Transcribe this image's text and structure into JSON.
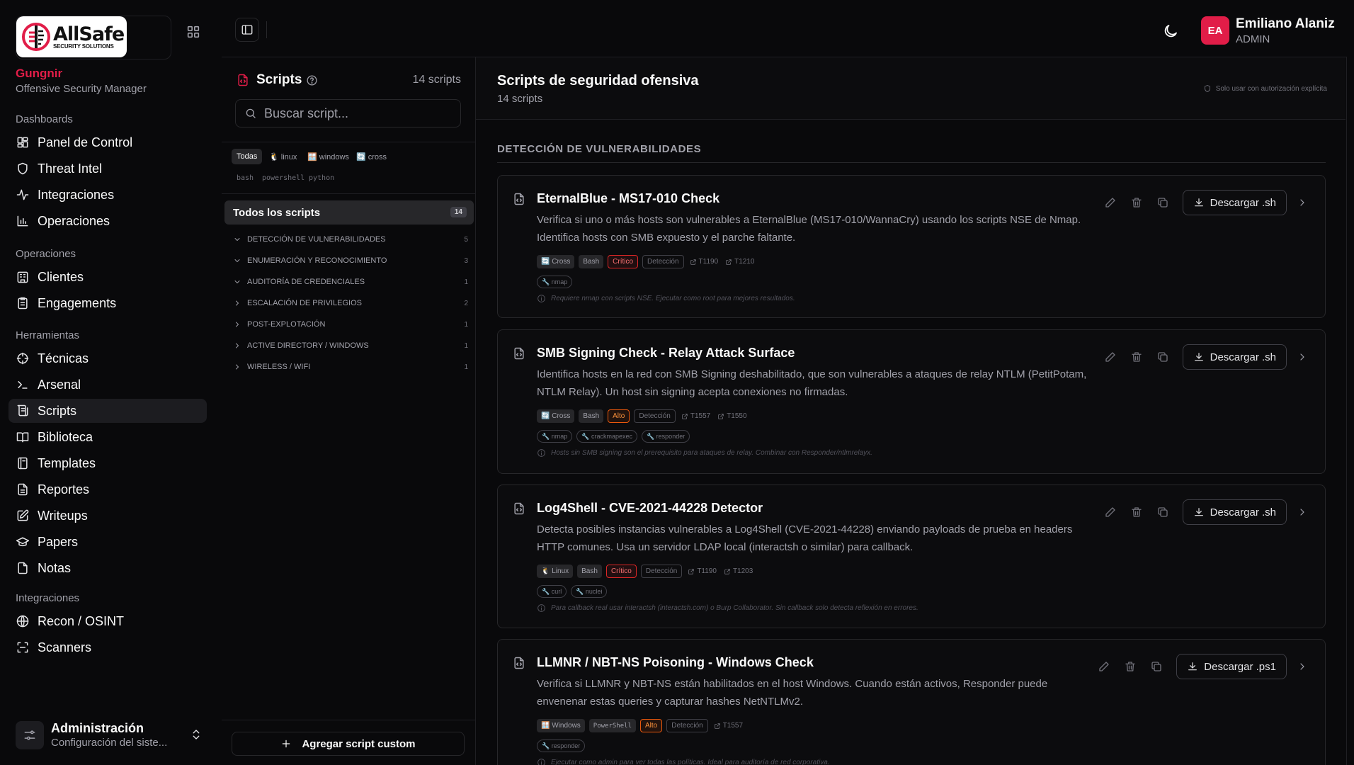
{
  "sidebar": {
    "logo": {
      "name": "AllSafe",
      "sub": "SECURITY SOLUTIONS"
    },
    "brand_title": "Gungnir",
    "brand_sub": "Offensive Security Manager",
    "sections": [
      {
        "label": "Dashboards",
        "items": [
          {
            "label": "Panel de Control",
            "icon": "dashboard-icon"
          },
          {
            "label": "Threat Intel",
            "icon": "shield-icon"
          },
          {
            "label": "Integraciones",
            "icon": "activity-icon"
          },
          {
            "label": "Operaciones",
            "icon": "bar-chart-icon"
          }
        ]
      },
      {
        "label": "Operaciones",
        "items": [
          {
            "label": "Clientes",
            "icon": "building-icon"
          },
          {
            "label": "Engagements",
            "icon": "clipboard-icon"
          }
        ]
      },
      {
        "label": "Herramientas",
        "items": [
          {
            "label": "Técnicas",
            "icon": "crosshair-icon"
          },
          {
            "label": "Arsenal",
            "icon": "terminal-icon"
          },
          {
            "label": "Scripts",
            "icon": "scroll-icon"
          },
          {
            "label": "Biblioteca",
            "icon": "book-open-icon"
          },
          {
            "label": "Templates",
            "icon": "notebook-icon"
          },
          {
            "label": "Reportes",
            "icon": "file-text-icon"
          },
          {
            "label": "Writeups",
            "icon": "edit-icon"
          },
          {
            "label": "Papers",
            "icon": "graduation-cap-icon"
          },
          {
            "label": "Notas",
            "icon": "file-icon"
          }
        ]
      },
      {
        "label": "Integraciones",
        "items": [
          {
            "label": "Recon / OSINT",
            "icon": "globe-icon"
          },
          {
            "label": "Scanners",
            "icon": "scan-icon"
          }
        ]
      }
    ],
    "active_item": "Scripts",
    "admin": {
      "title": "Administración",
      "sub": "Configuración del siste..."
    }
  },
  "topbar": {
    "user": {
      "initials": "EA",
      "name": "Emiliano Alaniz",
      "role": "ADMIN"
    },
    "avatar_color": "#e11d48"
  },
  "scripts_panel": {
    "title": "Scripts",
    "count": "14 scripts",
    "search_placeholder": "Buscar script...",
    "platform_filters": [
      {
        "label": "Todas",
        "active": true
      },
      {
        "label": "🐧 linux",
        "active": false
      },
      {
        "label": "🪟 windows",
        "active": false
      },
      {
        "label": "🔄 cross",
        "active": false
      }
    ],
    "language_filters": [
      "bash",
      "powershell",
      "python"
    ],
    "all_scripts": {
      "label": "Todos los scripts",
      "count": "14"
    },
    "categories": [
      {
        "label": "Detección de vulnerabilidades",
        "count": "5",
        "expanded": true
      },
      {
        "label": "Enumeración y reconocimiento",
        "count": "3",
        "expanded": true
      },
      {
        "label": "Auditoría de credenciales",
        "count": "1",
        "expanded": true
      },
      {
        "label": "Escalación de privilegios",
        "count": "2",
        "expanded": false
      },
      {
        "label": "Post-explotación",
        "count": "1",
        "expanded": false
      },
      {
        "label": "Active Directory / Windows",
        "count": "1",
        "expanded": false
      },
      {
        "label": "Wireless / WiFi",
        "count": "1",
        "expanded": false
      }
    ],
    "add_button": "Agregar script custom"
  },
  "main": {
    "title": "Scripts de seguridad ofensiva",
    "subtitle": "14 scripts",
    "auth_note": "Solo usar con autorización explícita",
    "group_title": "Detección de vulnerabilidades",
    "cards": [
      {
        "title": "EternalBlue - MS17-010 Check",
        "desc": "Verifica si uno o más hosts son vulnerables a EternalBlue (MS17-010/WannaCry) usando los scripts NSE de Nmap. Identifica hosts con SMB expuesto y el parche faltante.",
        "platform": "🔄 Cross",
        "lang": "Bash",
        "lang_mono": false,
        "severity": "Crítico",
        "severity_level": "critico",
        "category": "Detección",
        "mitre": [
          "T1190",
          "T1210"
        ],
        "tools": [
          "🔧 nmap"
        ],
        "note": "Requiere nmap con scripts NSE. Ejecutar como root para mejores resultados.",
        "download": "Descargar .sh"
      },
      {
        "title": "SMB Signing Check - Relay Attack Surface",
        "desc": "Identifica hosts en la red con SMB Signing deshabilitado, que son vulnerables a ataques de relay NTLM (PetitPotam, NTLM Relay). Un host sin signing acepta conexiones no firmadas.",
        "platform": "🔄 Cross",
        "lang": "Bash",
        "lang_mono": false,
        "severity": "Alto",
        "severity_level": "alto",
        "category": "Detección",
        "mitre": [
          "T1557",
          "T1550"
        ],
        "tools": [
          "🔧 nmap",
          "🔧 crackmapexec",
          "🔧 responder"
        ],
        "note": "Hosts sin SMB signing son el prerequisito para ataques de relay. Combinar con Responder/ntlmrelayx.",
        "download": "Descargar .sh"
      },
      {
        "title": "Log4Shell - CVE-2021-44228 Detector",
        "desc": "Detecta posibles instancias vulnerables a Log4Shell (CVE-2021-44228) enviando payloads de prueba en headers HTTP comunes. Usa un servidor LDAP local (interactsh o similar) para callback.",
        "platform": "🐧 Linux",
        "lang": "Bash",
        "lang_mono": false,
        "severity": "Crítico",
        "severity_level": "critico",
        "category": "Detección",
        "mitre": [
          "T1190",
          "T1203"
        ],
        "tools": [
          "🔧 curl",
          "🔧 nuclei"
        ],
        "note": "Para callback real usar interactsh (interactsh.com) o Burp Collaborator. Sin callback solo detecta reflexión en errores.",
        "download": "Descargar .sh"
      },
      {
        "title": "LLMNR / NBT-NS Poisoning - Windows Check",
        "desc": "Verifica si LLMNR y NBT-NS están habilitados en el host Windows. Cuando están activos, Responder puede envenenar estas queries y capturar hashes NetNTLMv2.",
        "platform": "🪟 Windows",
        "lang": "PowerShell",
        "lang_mono": true,
        "severity": "Alto",
        "severity_level": "alto",
        "category": "Detección",
        "mitre": [
          "T1557"
        ],
        "tools": [
          "🔧 responder"
        ],
        "note": "Ejecutar como admin para ver todas las políticas. Ideal para auditoría de red corporativa.",
        "download": "Descargar .ps1"
      }
    ]
  }
}
